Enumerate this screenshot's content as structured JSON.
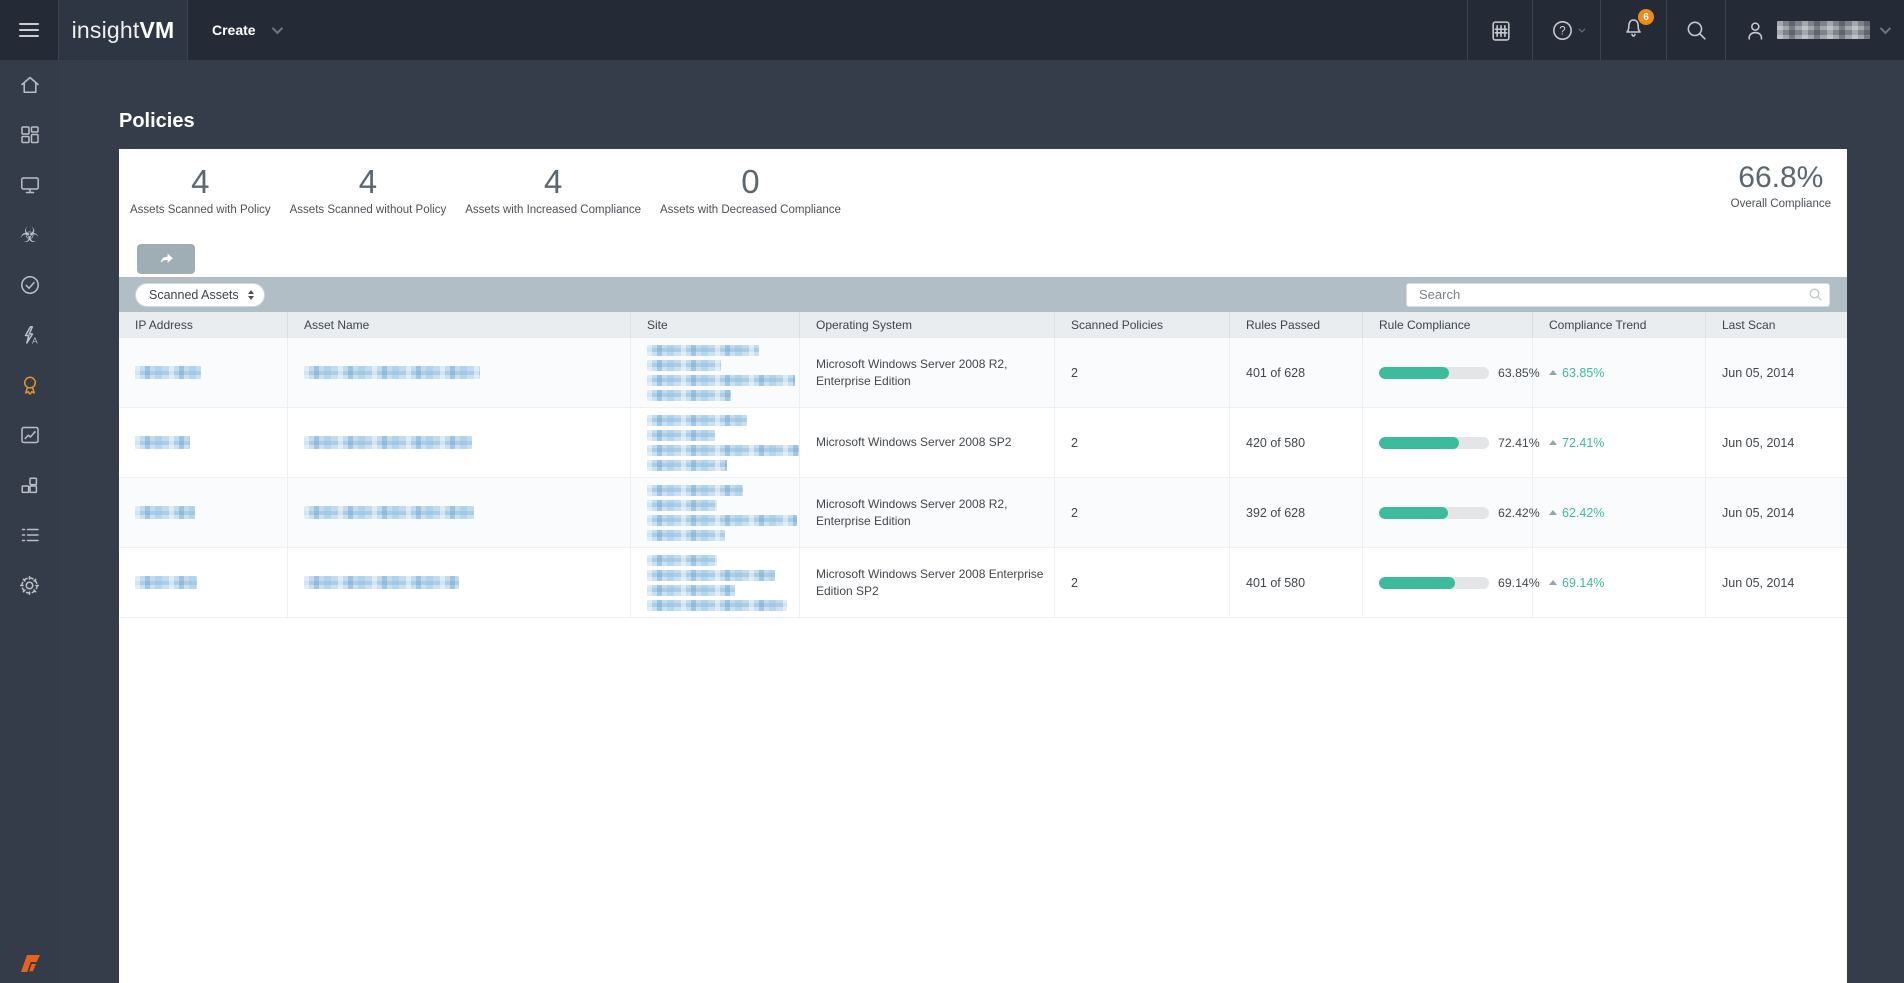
{
  "colors": {
    "teal": "#3dbc9d",
    "badge_orange": "#ee8a1e",
    "active_orange": "#e2952f",
    "rapid7_orange": "#e8611f"
  },
  "nav": {
    "brand": {
      "insight": "insight",
      "vm": "VM"
    },
    "create_label": "Create",
    "notification_count": "6",
    "help_label": "?",
    "username_redacted": true,
    "icons": [
      "menu-icon",
      "calendar-icon",
      "help-icon",
      "notifications-bell-icon",
      "search-icon",
      "user-icon",
      "chevron-down-icon"
    ]
  },
  "sidebar": {
    "active_item": "policies",
    "items": [
      {
        "id": "home",
        "icon": "home-icon"
      },
      {
        "id": "dashboards",
        "icon": "dashboard-grid-icon"
      },
      {
        "id": "assets",
        "icon": "monitor-icon"
      },
      {
        "id": "vulnerabilities",
        "icon": "biohazard-icon"
      },
      {
        "id": "remediation",
        "icon": "check-circle-icon"
      },
      {
        "id": "automation",
        "icon": "lightning-a-icon"
      },
      {
        "id": "policies",
        "icon": "ribbon-icon"
      },
      {
        "id": "goals",
        "icon": "chart-box-icon"
      },
      {
        "id": "plugins",
        "icon": "blocks-icon"
      },
      {
        "id": "management",
        "icon": "list-icon"
      },
      {
        "id": "administration",
        "icon": "gear-icon"
      }
    ],
    "footer_logo": "rapid7-logo"
  },
  "page": {
    "title": "Policies"
  },
  "stats": [
    {
      "value": "4",
      "label": "Assets Scanned with Policy"
    },
    {
      "value": "4",
      "label": "Assets Scanned without Policy"
    },
    {
      "value": "4",
      "label": "Assets with Increased Compliance"
    },
    {
      "value": "0",
      "label": "Assets with Decreased Compliance"
    }
  ],
  "overall": {
    "value": "66.8%",
    "label": "Overall Compliance"
  },
  "toolbar": {
    "share_icon": "share-arrow-icon",
    "filter_value": "Scanned Assets",
    "search_placeholder": "Search"
  },
  "table": {
    "columns": [
      "IP Address",
      "Asset Name",
      "Site",
      "Operating System",
      "Scanned Policies",
      "Rules Passed",
      "Rule Compliance",
      "Compliance Trend",
      "Last Scan"
    ],
    "rows": [
      {
        "ip_redacted": true,
        "asset_redacted": true,
        "site_redacted": true,
        "os": "Microsoft Windows Server 2008 R2, Enterprise Edition",
        "scanned_policies": "2",
        "rules_passed": "401 of 628",
        "rule_compliance": "63.85%",
        "rule_compliance_pct": 63.85,
        "trend": "63.85%",
        "trend_direction": "up",
        "last_scan": "Jun 05, 2014",
        "redacted": {
          "ip_w": 66,
          "asset_w": 176,
          "site_lines": [
            112,
            74,
            148,
            84
          ]
        }
      },
      {
        "ip_redacted": true,
        "asset_redacted": true,
        "site_redacted": true,
        "os": "Microsoft Windows Server 2008 SP2",
        "scanned_policies": "2",
        "rules_passed": "420 of 580",
        "rule_compliance": "72.41%",
        "rule_compliance_pct": 72.41,
        "trend": "72.41%",
        "trend_direction": "up",
        "last_scan": "Jun 05, 2014",
        "redacted": {
          "ip_w": 55,
          "asset_w": 168,
          "site_lines": [
            100,
            68,
            152,
            80
          ]
        }
      },
      {
        "ip_redacted": true,
        "asset_redacted": true,
        "site_redacted": true,
        "os": "Microsoft Windows Server 2008 R2, Enterprise Edition",
        "scanned_policies": "2",
        "rules_passed": "392 of 628",
        "rule_compliance": "62.42%",
        "rule_compliance_pct": 62.42,
        "trend": "62.42%",
        "trend_direction": "up",
        "last_scan": "Jun 05, 2014",
        "redacted": {
          "ip_w": 60,
          "asset_w": 170,
          "site_lines": [
            96,
            70,
            150,
            78
          ]
        }
      },
      {
        "ip_redacted": true,
        "asset_redacted": true,
        "site_redacted": true,
        "os": "Microsoft Windows Server 2008 Enterprise Edition SP2",
        "scanned_policies": "2",
        "rules_passed": "401 of 580",
        "rule_compliance": "69.14%",
        "rule_compliance_pct": 69.14,
        "trend": "69.14%",
        "trend_direction": "up",
        "last_scan": "Jun 05, 2014",
        "redacted": {
          "ip_w": 62,
          "asset_w": 155,
          "site_lines": [
            70,
            128,
            88,
            140
          ]
        }
      }
    ]
  }
}
